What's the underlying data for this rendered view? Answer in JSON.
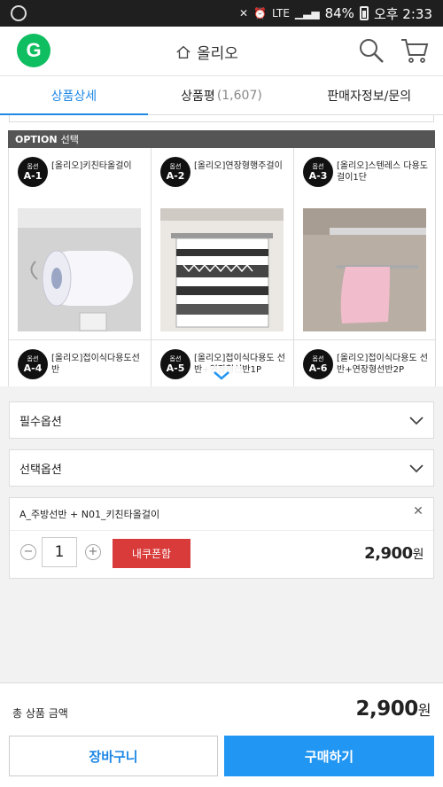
{
  "status_bar": {
    "battery": "84%",
    "time": "오후 2:33",
    "network": "LTE"
  },
  "header": {
    "logo_letter": "G",
    "title": "올리오"
  },
  "tabs": [
    {
      "label": "상품상세",
      "count": ""
    },
    {
      "label": "상품평",
      "count": "(1,607)"
    },
    {
      "label": "판매자정보/문의",
      "count": ""
    }
  ],
  "options_header": {
    "label": "OPTION",
    "sub": "선택"
  },
  "options": [
    {
      "badge_top": "옵션",
      "badge": "A-1",
      "name": "[올리오]키친타올걸이"
    },
    {
      "badge_top": "옵션",
      "badge": "A-2",
      "name": "[올리오]연장형행주걸이"
    },
    {
      "badge_top": "옵션",
      "badge": "A-3",
      "name": "[올리오]스텐레스 다용도걸이1단"
    },
    {
      "badge_top": "옵션",
      "badge": "A-4",
      "name": "[올리오]접이식다용도선반"
    },
    {
      "badge_top": "옵션",
      "badge": "A-5",
      "name": "[올리오]접이식다용도 선반+연장형선반1P"
    },
    {
      "badge_top": "옵션",
      "badge": "A-6",
      "name": "[올리오]접이식다용도 선반+연장형선반2P"
    }
  ],
  "selects": {
    "required": "필수옵션",
    "optional": "선택옵션"
  },
  "selected_item": {
    "name": "A_주방선반 + N01_키친타올걸이",
    "quantity": "1",
    "coupon_label": "내쿠폰함",
    "price": "2,900",
    "currency": "원"
  },
  "footer": {
    "total_label": "총 상품 금액",
    "total_price": "2,900",
    "currency": "원",
    "cart_label": "장바구니",
    "buy_label": "구매하기"
  },
  "colors": {
    "accent": "#1e88e5",
    "buy": "#2196f3",
    "coupon": "#d93a3a",
    "logo": "#0fbe60"
  }
}
